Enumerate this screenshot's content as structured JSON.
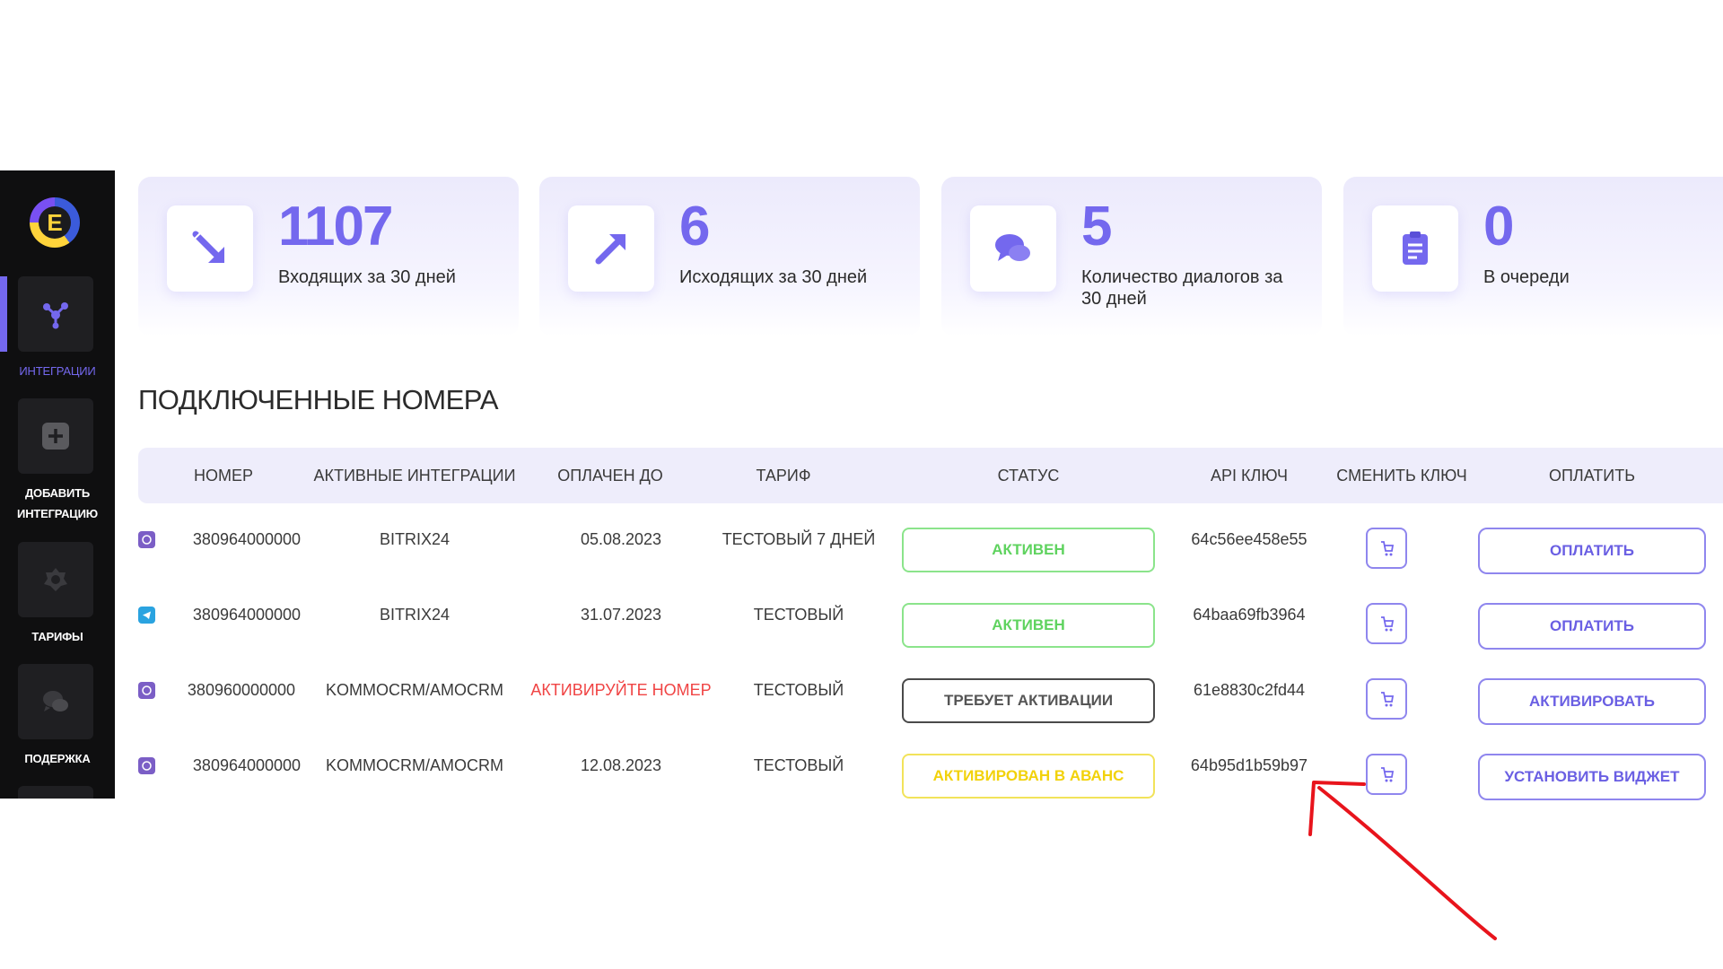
{
  "sidebar": {
    "logo_letter": "E",
    "items": [
      {
        "label": "ИНТЕГРАЦИИ",
        "icon": "share-icon",
        "active": true
      },
      {
        "label": "ДОБАВИТЬ ИНТЕГРАЦИЮ",
        "icon": "plus-square-icon",
        "active": false
      },
      {
        "label": "ТАРИФЫ",
        "icon": "badge-icon",
        "active": false
      },
      {
        "label": "ПОДЕРЖКА",
        "icon": "chat-bubbles-icon",
        "active": false
      }
    ]
  },
  "stats": [
    {
      "value": "1107",
      "label": "Входящих за 30 дней",
      "icon": "incoming-arrow-icon"
    },
    {
      "value": "6",
      "label": "Исходящих за 30 дней",
      "icon": "outgoing-arrow-icon"
    },
    {
      "value": "5",
      "label": "Количество диалогов за 30 дней",
      "icon": "chat-icon"
    },
    {
      "value": "0",
      "label": "В очереди",
      "icon": "clipboard-icon"
    }
  ],
  "section_title": "ПОДКЛЮЧЕННЫЕ НОМЕРА",
  "table": {
    "headers": [
      "НОМЕР",
      "АКТИВНЫЕ ИНТЕГРАЦИИ",
      "ОПЛАЧЕН ДО",
      "ТАРИФ",
      "СТАТУС",
      "API КЛЮЧ",
      "СМЕНИТЬ КЛЮЧ",
      "ОПЛАТИТЬ"
    ],
    "rows": [
      {
        "messenger": "viber",
        "number": "380964000000",
        "integration": "BITRIX24",
        "paid_until": "05.08.2023",
        "tariff": "ТЕСТОВЫЙ 7 ДНЕЙ",
        "status": "АКТИВЕН",
        "status_kind": "green",
        "api_key": "64c56ee458e55",
        "action": "ОПЛАТИТЬ"
      },
      {
        "messenger": "telegram",
        "number": "380964000000",
        "integration": "BITRIX24",
        "paid_until": "31.07.2023",
        "tariff": "ТЕСТОВЫЙ",
        "status": "АКТИВЕН",
        "status_kind": "green",
        "api_key": "64baa69fb3964",
        "action": "ОПЛАТИТЬ"
      },
      {
        "messenger": "viber",
        "number": "380960000000",
        "integration": "KOMMOCRM/AMOCRM",
        "paid_until": "АКТИВИРУЙТЕ НОМЕР",
        "tariff": "ТЕСТОВЫЙ",
        "status": "ТРЕБУЕТ АКТИВАЦИИ",
        "status_kind": "gray",
        "api_key": "61e8830c2fd44",
        "action": "АКТИВИРОВАТЬ"
      },
      {
        "messenger": "viber",
        "number": "380964000000",
        "integration": "KOMMOCRM/AMOCRM",
        "paid_until": "12.08.2023",
        "tariff": "ТЕСТОВЫЙ",
        "status": "АКТИВИРОВАН В АВАНС",
        "status_kind": "yellow",
        "api_key": "64b95d1b59b97",
        "action": "УСТАНОВИТЬ ВИДЖЕТ"
      }
    ]
  },
  "colors": {
    "accent": "#7468ee",
    "active": "#5fd35f",
    "warning": "#f2d20a",
    "error": "#f04444",
    "annotation": "#e8141c"
  }
}
